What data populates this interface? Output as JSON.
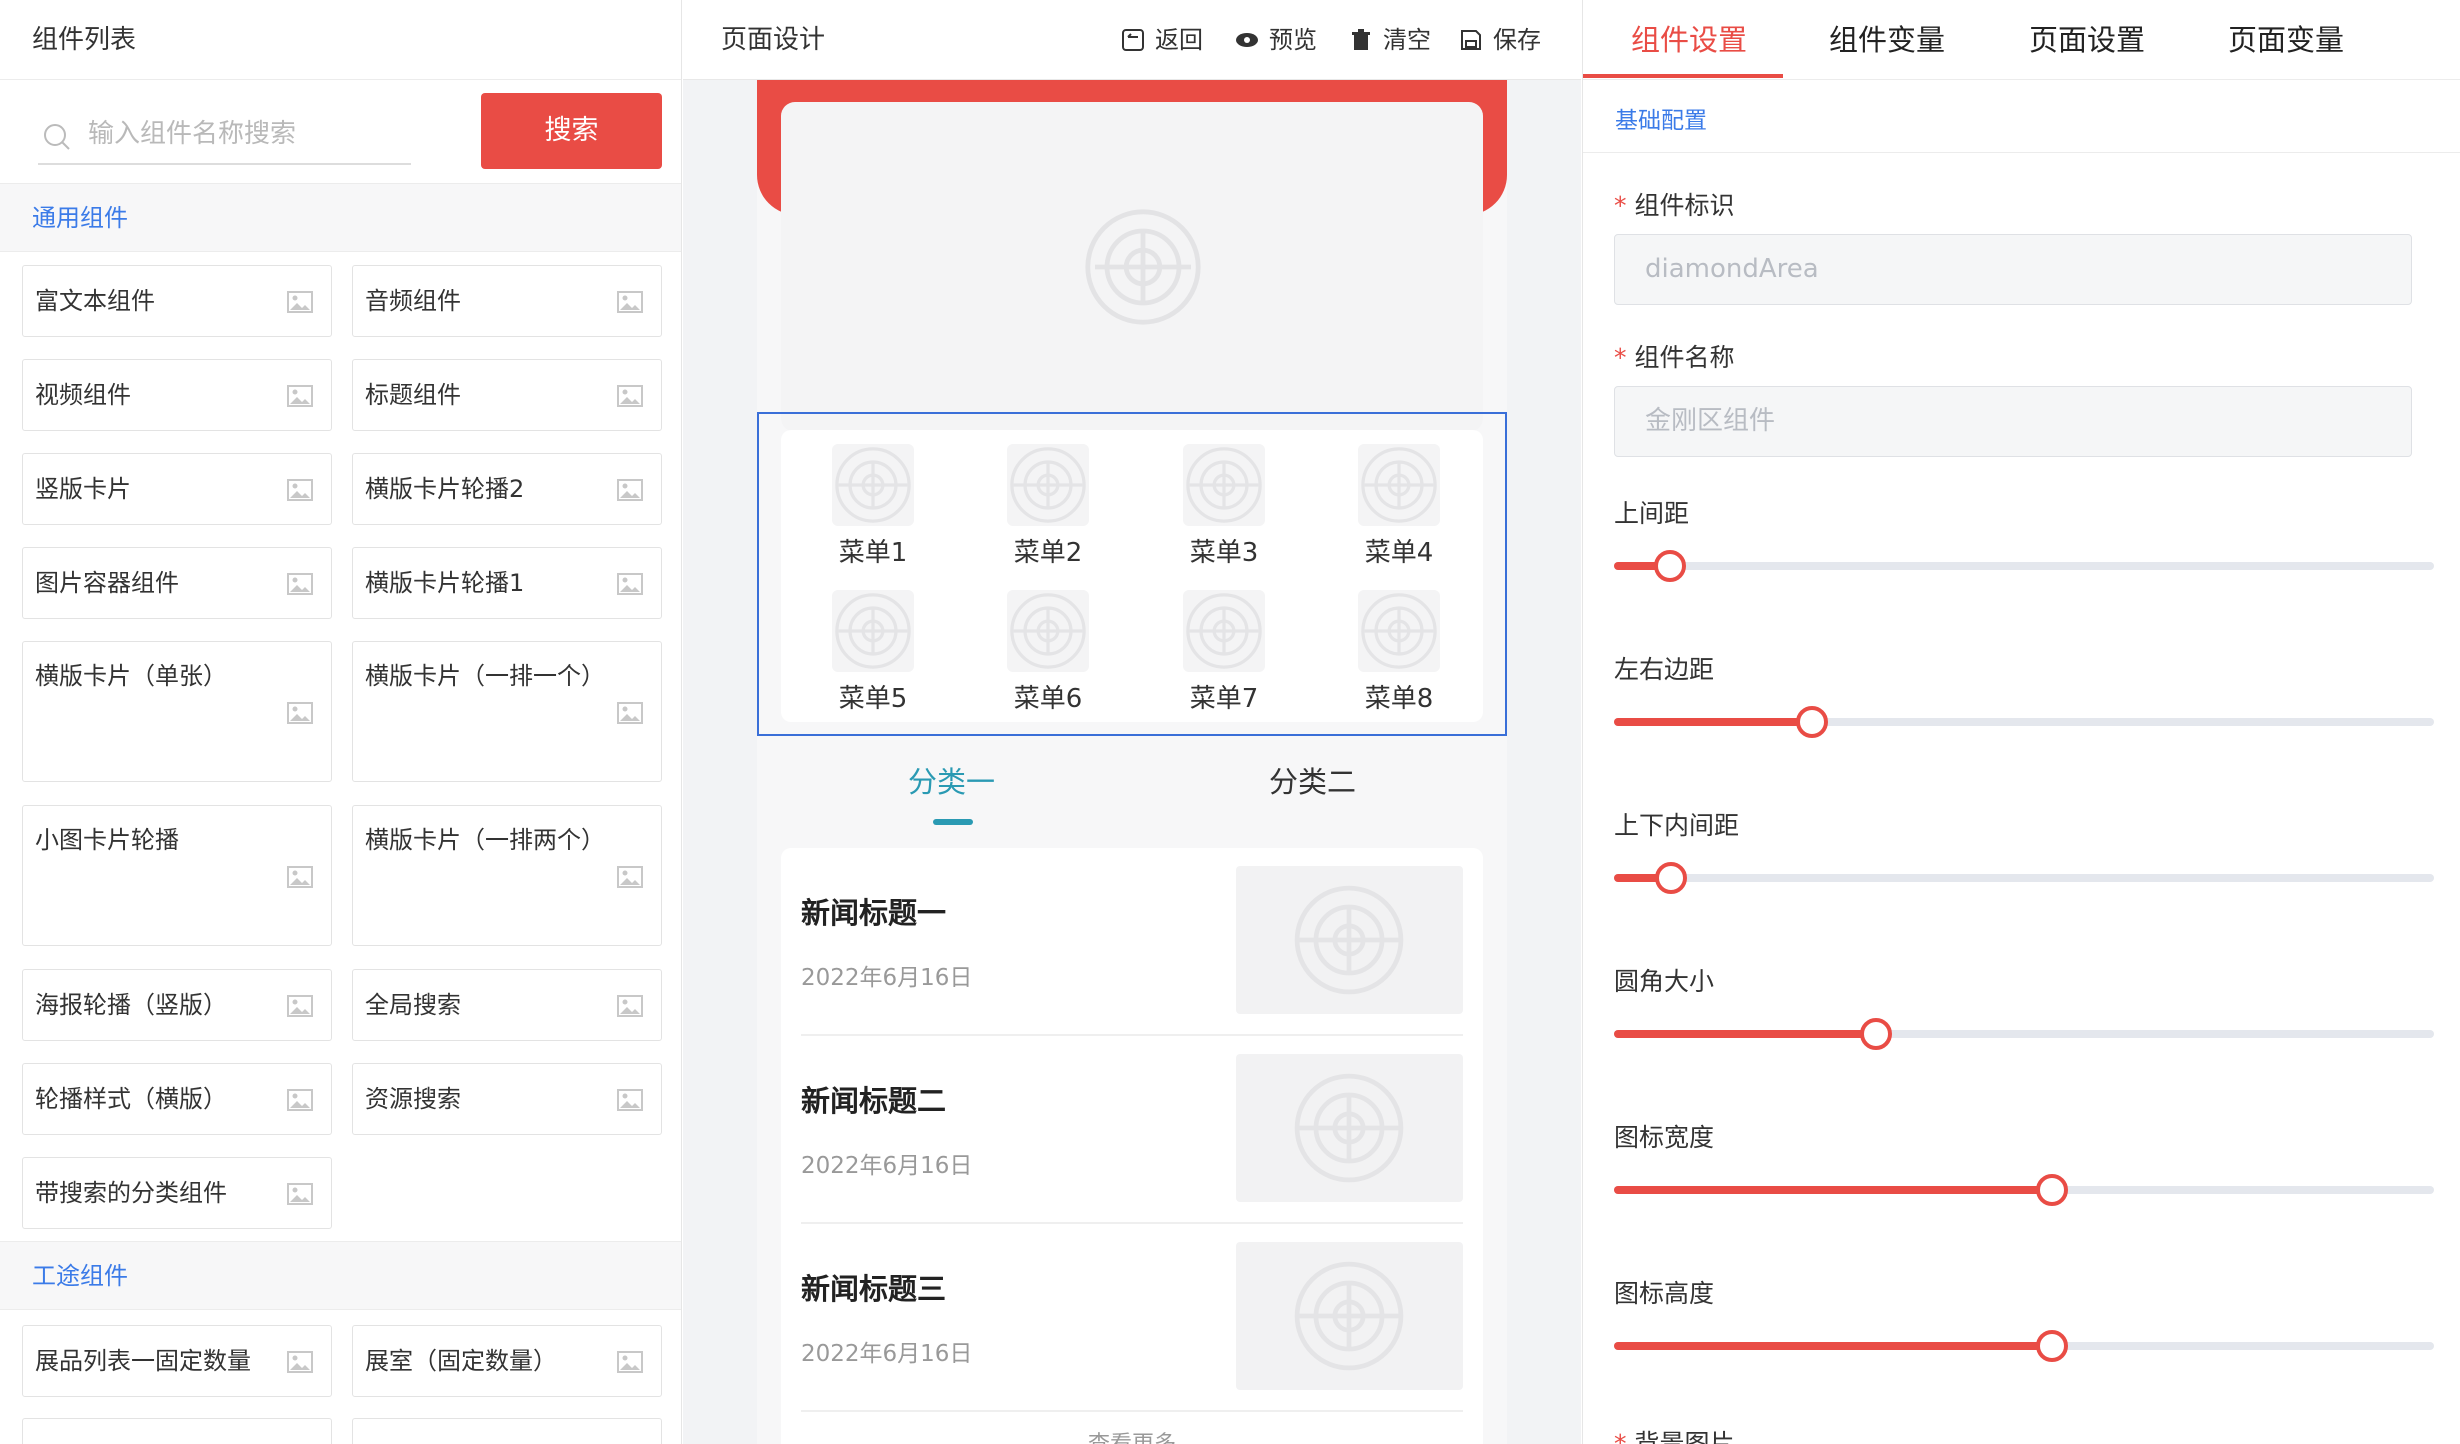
{
  "left": {
    "title": "组件列表",
    "search_placeholder": "输入组件名称搜索",
    "search_button": "搜索",
    "categories": [
      {
        "name": "通用组件",
        "items": [
          "富文本组件",
          "音频组件",
          "视频组件",
          "标题组件",
          "竖版卡片",
          "横版卡片轮播2",
          "图片容器组件",
          "横版卡片轮播1",
          "横版卡片（单张）",
          "横版卡片（一排一个）",
          "小图卡片轮播",
          "横版卡片（一排两个）",
          "海报轮播（竖版）",
          "全局搜索",
          "轮播样式（横版）",
          "资源搜索",
          "带搜索的分类组件"
        ]
      },
      {
        "name": "工途组件",
        "items": [
          "展品列表一固定数量",
          "展室（固定数量）"
        ]
      }
    ]
  },
  "mid": {
    "title": "页面设计",
    "toolbar": {
      "back": "返回",
      "preview": "预览",
      "clear": "清空",
      "save": "保存"
    },
    "menus": [
      "菜单1",
      "菜单2",
      "菜单3",
      "菜单4",
      "菜单5",
      "菜单6",
      "菜单7",
      "菜单8"
    ],
    "tabs": [
      "分类一",
      "分类二"
    ],
    "news": [
      {
        "title": "新闻标题一",
        "date": "2022年6月16日"
      },
      {
        "title": "新闻标题二",
        "date": "2022年6月16日"
      },
      {
        "title": "新闻标题三",
        "date": "2022年6月16日"
      }
    ],
    "more": "查看更多"
  },
  "right": {
    "tabs": [
      "组件设置",
      "组件变量",
      "页面设置",
      "页面变量"
    ],
    "active_tab": "组件设置",
    "section": "基础配置",
    "fields": {
      "id_label": "组件标识",
      "id_value": "diamondArea",
      "name_label": "组件名称",
      "name_value": "金刚区组件"
    },
    "sliders": [
      {
        "label": "上间距",
        "value": 0.068
      },
      {
        "label": "左右边距",
        "value": 0.242
      },
      {
        "label": "上下内间距",
        "value": 0.07
      },
      {
        "label": "圆角大小",
        "value": 0.32
      },
      {
        "label": "图标宽度",
        "value": 0.534
      },
      {
        "label": "图标高度",
        "value": 0.534
      }
    ],
    "next_label": "背景图片"
  },
  "colors": {
    "accent": "#e94c45",
    "link": "#3b7be8",
    "tab_active": "#2a9ab3",
    "selection": "#3a6fd8"
  }
}
